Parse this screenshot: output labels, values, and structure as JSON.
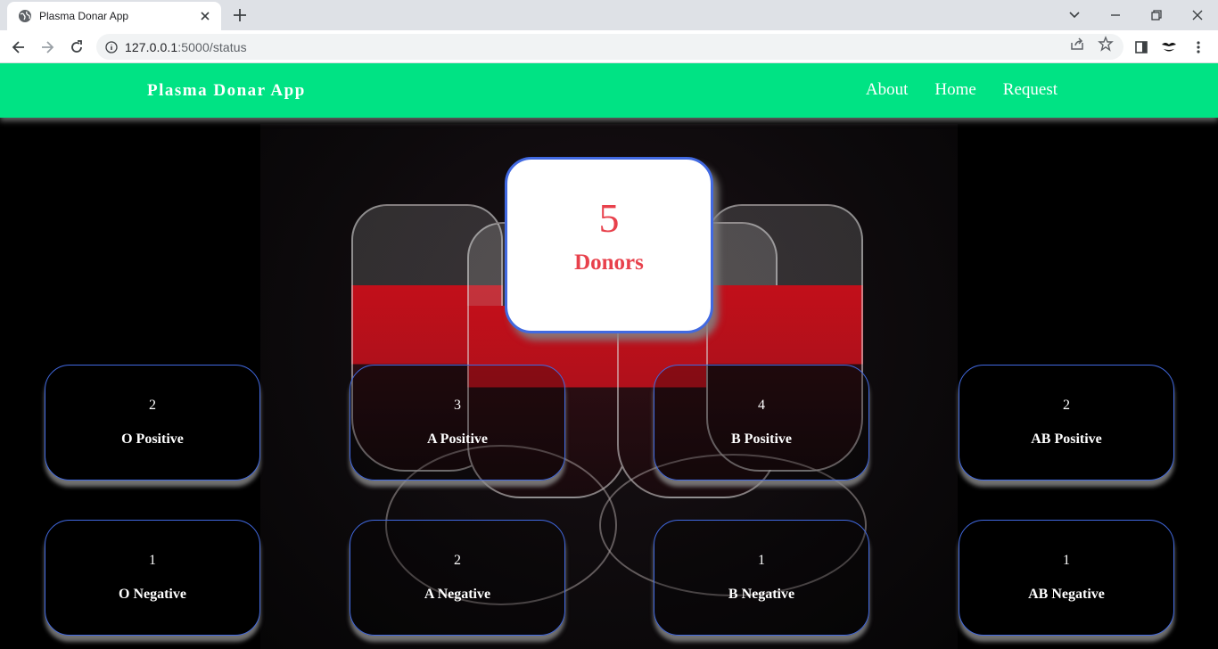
{
  "browser": {
    "tab_title": "Plasma Donar App",
    "url_host": "127.0.0.1",
    "url_rest": ":5000/status"
  },
  "navbar": {
    "brand": "Plasma Donar App",
    "links": [
      "About",
      "Home",
      "Request"
    ],
    "color": "#00e384"
  },
  "total": {
    "count": "5",
    "label": "Donors"
  },
  "blood_groups": [
    {
      "count": "2",
      "label": "O Positive"
    },
    {
      "count": "3",
      "label": "A Positive"
    },
    {
      "count": "4",
      "label": "B Positive"
    },
    {
      "count": "2",
      "label": "AB Positive"
    },
    {
      "count": "1",
      "label": "O Negative"
    },
    {
      "count": "2",
      "label": "A Negative"
    },
    {
      "count": "1",
      "label": "B Negative"
    },
    {
      "count": "1",
      "label": "AB Negative"
    }
  ]
}
